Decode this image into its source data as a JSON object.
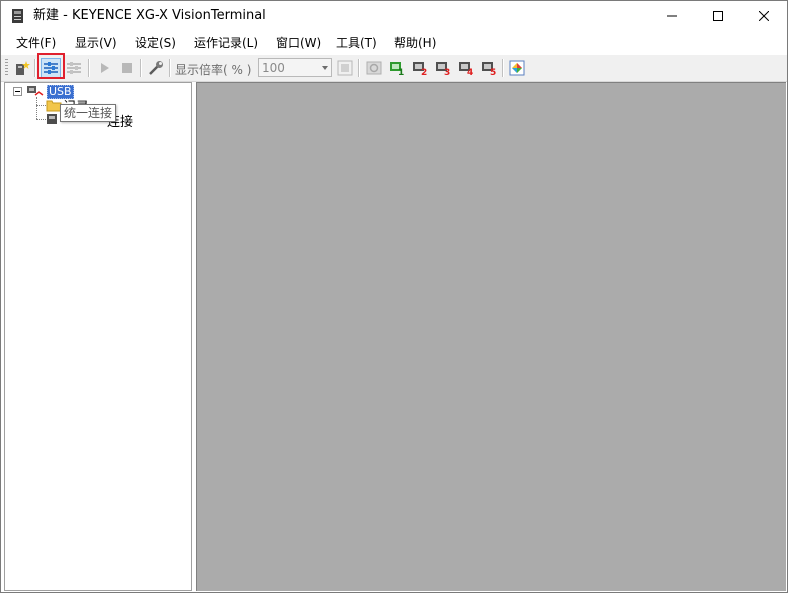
{
  "window": {
    "title": "新建 - KEYENCE XG-X VisionTerminal"
  },
  "menu": {
    "items": [
      {
        "label": "文件(F)"
      },
      {
        "label": "显示(V)"
      },
      {
        "label": "设定(S)"
      },
      {
        "label": "运作记录(L)"
      },
      {
        "label": "窗口(W)"
      },
      {
        "label": "工具(T)"
      },
      {
        "label": "帮助(H)"
      }
    ]
  },
  "toolbar": {
    "zoom_label": "显示倍率( % )",
    "zoom_value": "100",
    "buttons": [
      {
        "icon": "new-project-icon"
      },
      {
        "icon": "unified-connect-icon",
        "highlighted": true
      },
      {
        "icon": "unified-disconnect-icon",
        "enabled": false
      },
      {
        "icon": "play-icon",
        "enabled": false
      },
      {
        "icon": "stop-icon",
        "enabled": false
      },
      {
        "icon": "wrench-icon"
      },
      {
        "icon": "fit-screen-icon",
        "enabled": false
      },
      {
        "icon": "refresh-icon",
        "enabled": false
      },
      {
        "icon": "monitor-1-icon"
      },
      {
        "icon": "monitor-2-icon"
      },
      {
        "icon": "monitor-3-icon"
      },
      {
        "icon": "monitor-4-icon"
      },
      {
        "icon": "monitor-5-icon"
      },
      {
        "icon": "color-palette-icon"
      }
    ]
  },
  "tree": {
    "root_label": "USB",
    "children": [
      {
        "label": "记录"
      },
      {
        "label": "连接"
      }
    ]
  },
  "tooltip": {
    "text": "统一连接"
  },
  "colors": {
    "highlight": "#e0202e",
    "selection": "#3a6fd0",
    "workspace": "#ababab"
  }
}
